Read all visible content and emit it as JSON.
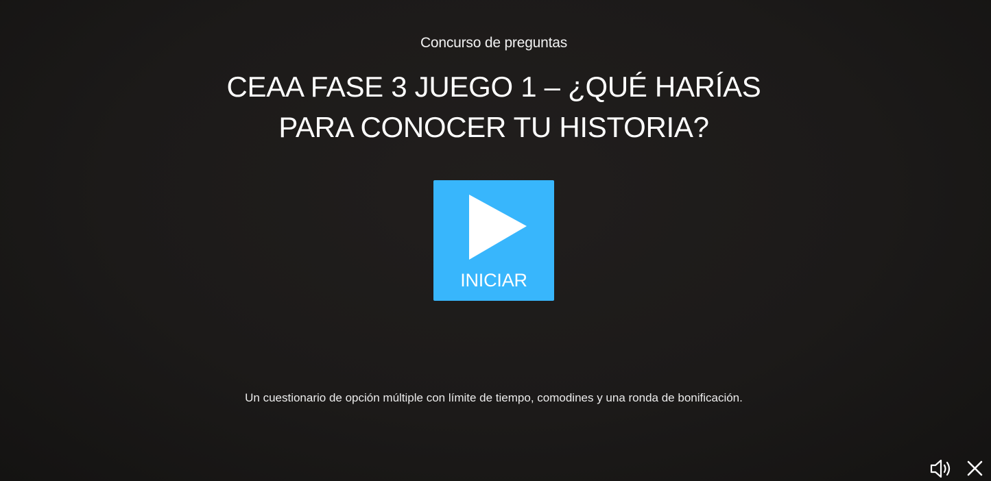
{
  "header": {
    "subtitle": "Concurso de preguntas",
    "title_line1": "CEAA FASE 3 JUEGO 1 – ¿QUÉ HARÍAS",
    "title_line2": "PARA CONOCER TU HISTORIA?"
  },
  "start_button": {
    "label": "INICIAR",
    "icon": "play-icon",
    "color": "#38b6fc"
  },
  "description": "Un cuestionario de opción múltiple con límite de tiempo, comodines y una ronda de bonificación.",
  "controls": {
    "sound_icon": "speaker-icon",
    "close_icon": "close-icon"
  },
  "colors": {
    "background": "#1b1918",
    "text": "#ffffff",
    "accent": "#38b6fc"
  }
}
